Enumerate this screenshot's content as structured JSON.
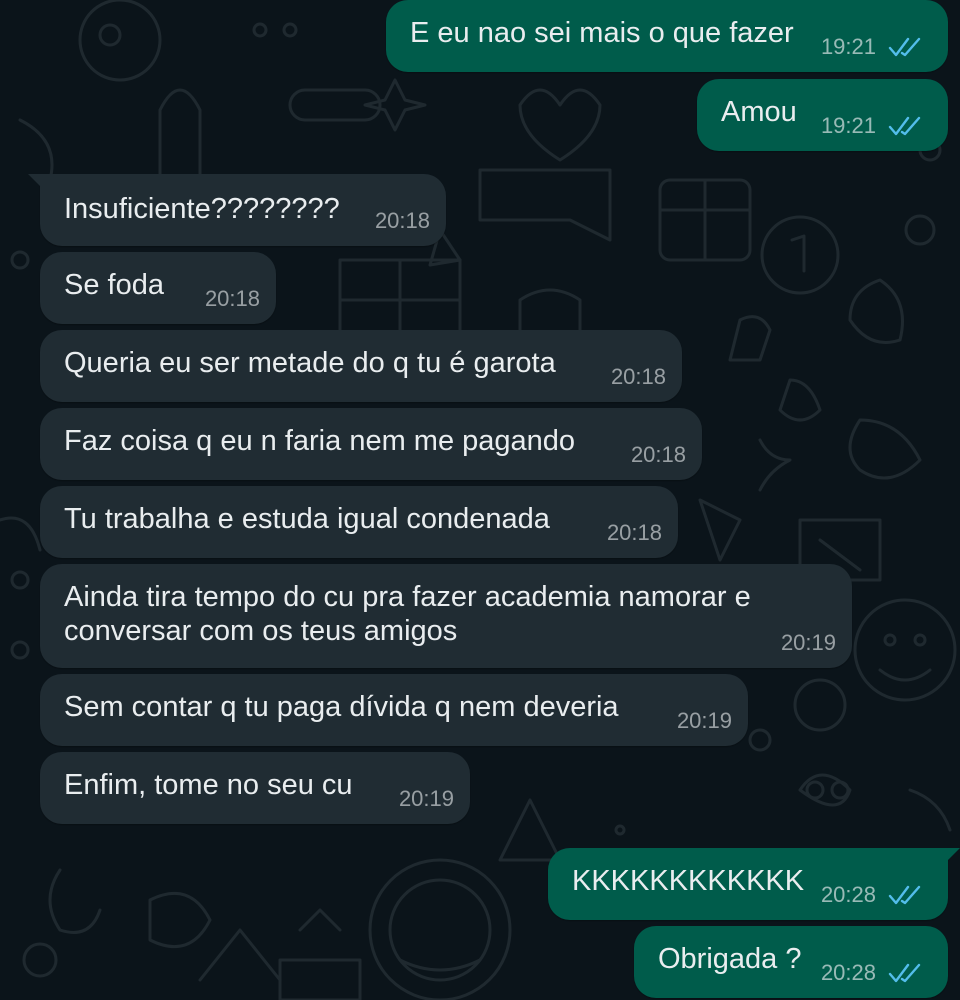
{
  "colors": {
    "background": "#0b141a",
    "incoming_bubble": "#202c33",
    "outgoing_bubble": "#005c4b",
    "text": "#e9edef",
    "read_ticks": "#53bdeb"
  },
  "messages": [
    {
      "direction": "out",
      "text": "E eu nao sei mais o que fazer",
      "time": "19:21",
      "status": "read-double-check-icon"
    },
    {
      "direction": "out",
      "text": "Amou",
      "time": "19:21",
      "status": "read-double-check-icon"
    },
    {
      "direction": "in",
      "text": "Insuficiente????????",
      "time": "20:18"
    },
    {
      "direction": "in",
      "text": "Se foda",
      "time": "20:18"
    },
    {
      "direction": "in",
      "text": "Queria eu ser metade do q tu é garota",
      "time": "20:18"
    },
    {
      "direction": "in",
      "text": "Faz coisa q eu n faria nem me pagando",
      "time": "20:18"
    },
    {
      "direction": "in",
      "text": "Tu trabalha e estuda igual condenada",
      "time": "20:18"
    },
    {
      "direction": "in",
      "text": "Ainda tira tempo do cu pra fazer academia namorar e",
      "text_line2": "conversar com os teus amigos",
      "time": "20:19"
    },
    {
      "direction": "in",
      "text": "Sem contar q tu paga dívida q nem deveria",
      "time": "20:19"
    },
    {
      "direction": "in",
      "text": "Enfim, tome no seu cu",
      "time": "20:19"
    },
    {
      "direction": "out",
      "text": "KKKKKKKKKKKK",
      "time": "20:28",
      "status": "read-double-check-icon"
    },
    {
      "direction": "out",
      "text": "Obrigada ?",
      "time": "20:28",
      "status": "read-double-check-icon"
    }
  ]
}
